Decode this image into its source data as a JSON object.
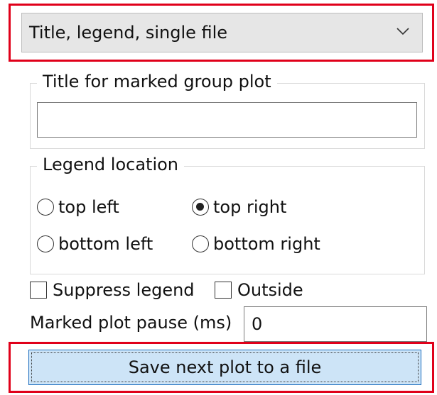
{
  "dropdown": {
    "value": "Title, legend, single file"
  },
  "title_group": {
    "label": "Title for marked group plot",
    "value": ""
  },
  "legend_group": {
    "label": "Legend location",
    "options": [
      {
        "label": "top left",
        "selected": false
      },
      {
        "label": "top right",
        "selected": true
      },
      {
        "label": "bottom left",
        "selected": false
      },
      {
        "label": "bottom right",
        "selected": false
      }
    ]
  },
  "checks": {
    "suppress": {
      "label": "Suppress legend",
      "checked": false
    },
    "outside": {
      "label": "Outside",
      "checked": false
    }
  },
  "pause": {
    "label": "Marked plot pause (ms)",
    "value": "0"
  },
  "save_button": {
    "label": "Save next plot to a file"
  },
  "colors": {
    "highlight": "#e0001a",
    "button_bg": "#cde4f7",
    "button_border": "#1f6fbf"
  },
  "icons": {
    "dropdown": "chevron-down-icon"
  }
}
